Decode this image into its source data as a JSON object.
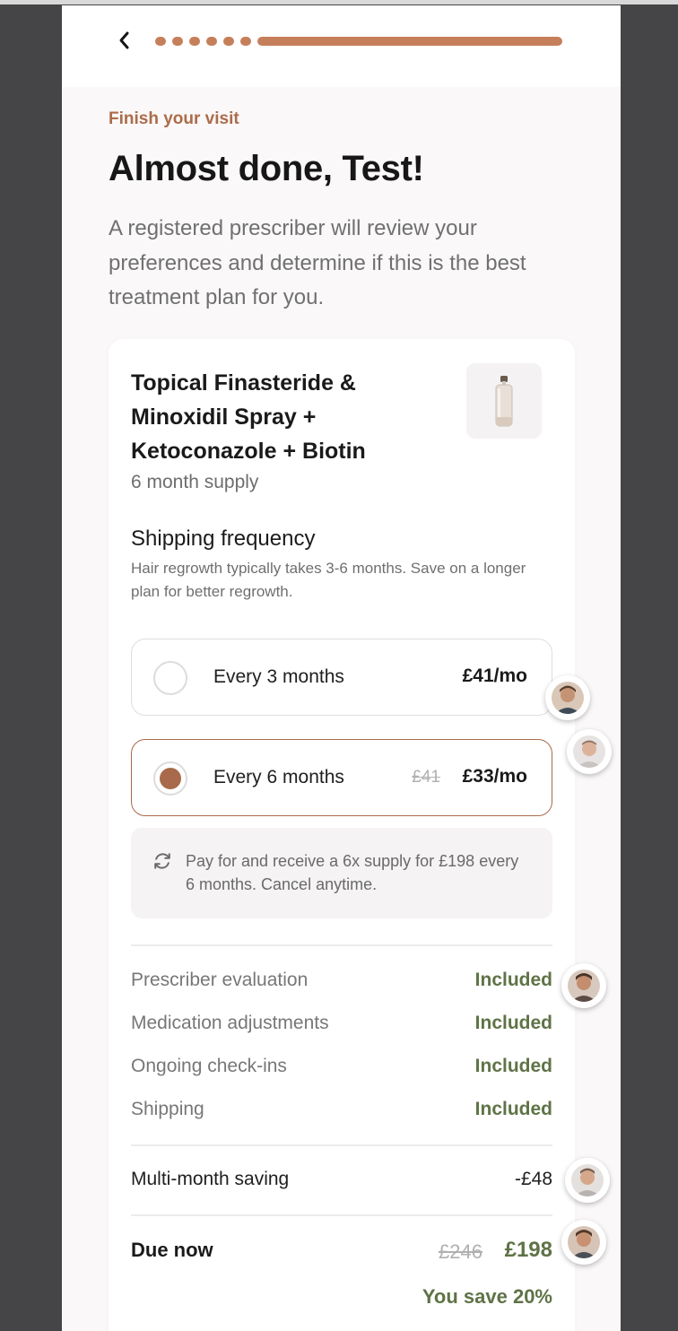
{
  "header": {
    "progress_steps_completed": 6,
    "back_icon": "chevron-left-icon"
  },
  "intro": {
    "eyebrow": "Finish your visit",
    "title": "Almost done, Test!",
    "lead": "A registered prescriber will review your preferences and determine if this is the best treatment plan for you."
  },
  "product": {
    "title": "Topical Finasteride & Minoxidil Spray + Ketoconazole + Biotin",
    "supply": "6 month supply",
    "image_icon": "spray-bottle-icon"
  },
  "shipping": {
    "title": "Shipping frequency",
    "description": "Hair regrowth typically takes 3-6 months. Save on a longer plan for better regrowth.",
    "options": [
      {
        "label": "Every 3 months",
        "price": "£41/mo",
        "old_price": "",
        "selected": false
      },
      {
        "label": "Every 6 months",
        "price": "£33/mo",
        "old_price": "£41",
        "selected": true
      }
    ],
    "note": "Pay for and receive a 6x supply for £198 every 6 months. Cancel anytime.",
    "note_icon": "refresh-icon"
  },
  "included": [
    {
      "label": "Prescriber evaluation",
      "value": "Included"
    },
    {
      "label": "Medication adjustments",
      "value": "Included"
    },
    {
      "label": "Ongoing check-ins",
      "value": "Included"
    },
    {
      "label": "Shipping",
      "value": "Included"
    }
  ],
  "summary": {
    "saving_label": "Multi-month saving",
    "saving_value": "-£48",
    "due_label": "Due now",
    "due_old": "£246",
    "due_new": "£198",
    "save_text": "You save 20%"
  },
  "colors": {
    "accent": "#c67f5b",
    "accent_dark": "#a86a4a",
    "positive": "#5f7347",
    "backdrop": "#454447"
  }
}
